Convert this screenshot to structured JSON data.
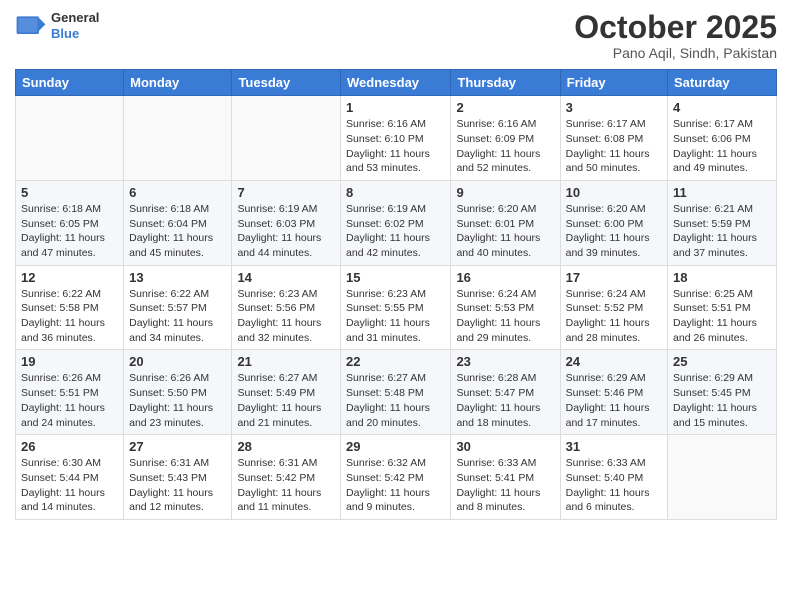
{
  "header": {
    "logo_line1": "General",
    "logo_line2": "Blue",
    "month_title": "October 2025",
    "location": "Pano Aqil, Sindh, Pakistan"
  },
  "weekdays": [
    "Sunday",
    "Monday",
    "Tuesday",
    "Wednesday",
    "Thursday",
    "Friday",
    "Saturday"
  ],
  "weeks": [
    [
      {
        "day": "",
        "sunrise": "",
        "sunset": "",
        "daylight": ""
      },
      {
        "day": "",
        "sunrise": "",
        "sunset": "",
        "daylight": ""
      },
      {
        "day": "",
        "sunrise": "",
        "sunset": "",
        "daylight": ""
      },
      {
        "day": "1",
        "sunrise": "Sunrise: 6:16 AM",
        "sunset": "Sunset: 6:10 PM",
        "daylight": "Daylight: 11 hours and 53 minutes."
      },
      {
        "day": "2",
        "sunrise": "Sunrise: 6:16 AM",
        "sunset": "Sunset: 6:09 PM",
        "daylight": "Daylight: 11 hours and 52 minutes."
      },
      {
        "day": "3",
        "sunrise": "Sunrise: 6:17 AM",
        "sunset": "Sunset: 6:08 PM",
        "daylight": "Daylight: 11 hours and 50 minutes."
      },
      {
        "day": "4",
        "sunrise": "Sunrise: 6:17 AM",
        "sunset": "Sunset: 6:06 PM",
        "daylight": "Daylight: 11 hours and 49 minutes."
      }
    ],
    [
      {
        "day": "5",
        "sunrise": "Sunrise: 6:18 AM",
        "sunset": "Sunset: 6:05 PM",
        "daylight": "Daylight: 11 hours and 47 minutes."
      },
      {
        "day": "6",
        "sunrise": "Sunrise: 6:18 AM",
        "sunset": "Sunset: 6:04 PM",
        "daylight": "Daylight: 11 hours and 45 minutes."
      },
      {
        "day": "7",
        "sunrise": "Sunrise: 6:19 AM",
        "sunset": "Sunset: 6:03 PM",
        "daylight": "Daylight: 11 hours and 44 minutes."
      },
      {
        "day": "8",
        "sunrise": "Sunrise: 6:19 AM",
        "sunset": "Sunset: 6:02 PM",
        "daylight": "Daylight: 11 hours and 42 minutes."
      },
      {
        "day": "9",
        "sunrise": "Sunrise: 6:20 AM",
        "sunset": "Sunset: 6:01 PM",
        "daylight": "Daylight: 11 hours and 40 minutes."
      },
      {
        "day": "10",
        "sunrise": "Sunrise: 6:20 AM",
        "sunset": "Sunset: 6:00 PM",
        "daylight": "Daylight: 11 hours and 39 minutes."
      },
      {
        "day": "11",
        "sunrise": "Sunrise: 6:21 AM",
        "sunset": "Sunset: 5:59 PM",
        "daylight": "Daylight: 11 hours and 37 minutes."
      }
    ],
    [
      {
        "day": "12",
        "sunrise": "Sunrise: 6:22 AM",
        "sunset": "Sunset: 5:58 PM",
        "daylight": "Daylight: 11 hours and 36 minutes."
      },
      {
        "day": "13",
        "sunrise": "Sunrise: 6:22 AM",
        "sunset": "Sunset: 5:57 PM",
        "daylight": "Daylight: 11 hours and 34 minutes."
      },
      {
        "day": "14",
        "sunrise": "Sunrise: 6:23 AM",
        "sunset": "Sunset: 5:56 PM",
        "daylight": "Daylight: 11 hours and 32 minutes."
      },
      {
        "day": "15",
        "sunrise": "Sunrise: 6:23 AM",
        "sunset": "Sunset: 5:55 PM",
        "daylight": "Daylight: 11 hours and 31 minutes."
      },
      {
        "day": "16",
        "sunrise": "Sunrise: 6:24 AM",
        "sunset": "Sunset: 5:53 PM",
        "daylight": "Daylight: 11 hours and 29 minutes."
      },
      {
        "day": "17",
        "sunrise": "Sunrise: 6:24 AM",
        "sunset": "Sunset: 5:52 PM",
        "daylight": "Daylight: 11 hours and 28 minutes."
      },
      {
        "day": "18",
        "sunrise": "Sunrise: 6:25 AM",
        "sunset": "Sunset: 5:51 PM",
        "daylight": "Daylight: 11 hours and 26 minutes."
      }
    ],
    [
      {
        "day": "19",
        "sunrise": "Sunrise: 6:26 AM",
        "sunset": "Sunset: 5:51 PM",
        "daylight": "Daylight: 11 hours and 24 minutes."
      },
      {
        "day": "20",
        "sunrise": "Sunrise: 6:26 AM",
        "sunset": "Sunset: 5:50 PM",
        "daylight": "Daylight: 11 hours and 23 minutes."
      },
      {
        "day": "21",
        "sunrise": "Sunrise: 6:27 AM",
        "sunset": "Sunset: 5:49 PM",
        "daylight": "Daylight: 11 hours and 21 minutes."
      },
      {
        "day": "22",
        "sunrise": "Sunrise: 6:27 AM",
        "sunset": "Sunset: 5:48 PM",
        "daylight": "Daylight: 11 hours and 20 minutes."
      },
      {
        "day": "23",
        "sunrise": "Sunrise: 6:28 AM",
        "sunset": "Sunset: 5:47 PM",
        "daylight": "Daylight: 11 hours and 18 minutes."
      },
      {
        "day": "24",
        "sunrise": "Sunrise: 6:29 AM",
        "sunset": "Sunset: 5:46 PM",
        "daylight": "Daylight: 11 hours and 17 minutes."
      },
      {
        "day": "25",
        "sunrise": "Sunrise: 6:29 AM",
        "sunset": "Sunset: 5:45 PM",
        "daylight": "Daylight: 11 hours and 15 minutes."
      }
    ],
    [
      {
        "day": "26",
        "sunrise": "Sunrise: 6:30 AM",
        "sunset": "Sunset: 5:44 PM",
        "daylight": "Daylight: 11 hours and 14 minutes."
      },
      {
        "day": "27",
        "sunrise": "Sunrise: 6:31 AM",
        "sunset": "Sunset: 5:43 PM",
        "daylight": "Daylight: 11 hours and 12 minutes."
      },
      {
        "day": "28",
        "sunrise": "Sunrise: 6:31 AM",
        "sunset": "Sunset: 5:42 PM",
        "daylight": "Daylight: 11 hours and 11 minutes."
      },
      {
        "day": "29",
        "sunrise": "Sunrise: 6:32 AM",
        "sunset": "Sunset: 5:42 PM",
        "daylight": "Daylight: 11 hours and 9 minutes."
      },
      {
        "day": "30",
        "sunrise": "Sunrise: 6:33 AM",
        "sunset": "Sunset: 5:41 PM",
        "daylight": "Daylight: 11 hours and 8 minutes."
      },
      {
        "day": "31",
        "sunrise": "Sunrise: 6:33 AM",
        "sunset": "Sunset: 5:40 PM",
        "daylight": "Daylight: 11 hours and 6 minutes."
      },
      {
        "day": "",
        "sunrise": "",
        "sunset": "",
        "daylight": ""
      }
    ]
  ]
}
